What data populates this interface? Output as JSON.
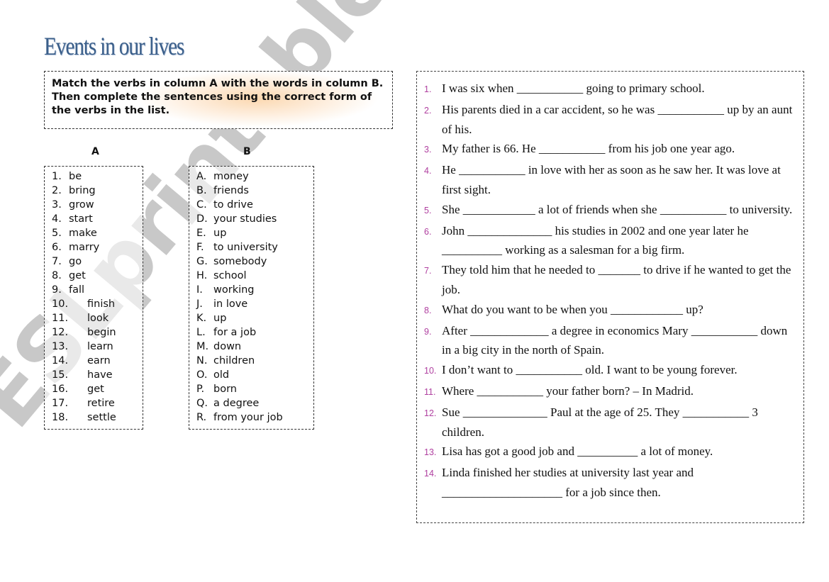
{
  "title": "Events in our lives",
  "instructions": "Match the verbs in column A with the words in column B. Then complete the sentences using the correct form of the verbs in the list.",
  "column_a": {
    "heading": "A",
    "items": [
      {
        "n": "1.",
        "w": "be"
      },
      {
        "n": "2.",
        "w": "bring"
      },
      {
        "n": "3.",
        "w": "grow"
      },
      {
        "n": "4.",
        "w": "start"
      },
      {
        "n": "5.",
        "w": "make"
      },
      {
        "n": "6.",
        "w": "marry"
      },
      {
        "n": "7.",
        "w": "go"
      },
      {
        "n": "8.",
        "w": "get"
      },
      {
        "n": "9.",
        "w": "fall"
      },
      {
        "n": "10.",
        "w": "finish"
      },
      {
        "n": "11.",
        "w": "look"
      },
      {
        "n": "12.",
        "w": "begin"
      },
      {
        "n": "13.",
        "w": "learn"
      },
      {
        "n": "14.",
        "w": "earn"
      },
      {
        "n": "15.",
        "w": "have"
      },
      {
        "n": "16.",
        "w": "get"
      },
      {
        "n": "17.",
        "w": "retire"
      },
      {
        "n": "18.",
        "w": "settle"
      }
    ]
  },
  "column_b": {
    "heading": "B",
    "items": [
      {
        "n": "A.",
        "w": "money"
      },
      {
        "n": "B.",
        "w": "friends"
      },
      {
        "n": "C.",
        "w": "to drive"
      },
      {
        "n": "D.",
        "w": "your studies"
      },
      {
        "n": "E.",
        "w": "up"
      },
      {
        "n": "F.",
        "w": "to university"
      },
      {
        "n": "G.",
        "w": "somebody"
      },
      {
        "n": "H.",
        "w": "school"
      },
      {
        "n": "I.",
        "w": "working"
      },
      {
        "n": "J.",
        "w": "in love"
      },
      {
        "n": "K.",
        "w": "up"
      },
      {
        "n": "L.",
        "w": "for a job"
      },
      {
        "n": "M.",
        "w": "down"
      },
      {
        "n": "N.",
        "w": "children"
      },
      {
        "n": "O.",
        "w": "old"
      },
      {
        "n": "P.",
        "w": "born"
      },
      {
        "n": "Q.",
        "w": "a degree"
      },
      {
        "n": "R.",
        "w": "from your job"
      }
    ]
  },
  "sentences": [
    {
      "n": "1.",
      "t": "I was six when ___________ going to primary school."
    },
    {
      "n": "2.",
      "t": "His parents died in a car accident, so he was ___________ up by an aunt of his."
    },
    {
      "n": "3.",
      "t": "My father is 66. He ___________ from his job one year ago."
    },
    {
      "n": "4.",
      "t": "He ___________ in love with her as soon as he saw her. It was love at first sight."
    },
    {
      "n": "5.",
      "t": "She ____________ a lot of friends when she ___________ to university."
    },
    {
      "n": "6.",
      "t": "John ______________ his studies in 2002 and one year later he __________ working as a salesman for a big firm."
    },
    {
      "n": "7.",
      "t": "They told him that he needed to _______ to drive if he wanted to get the job."
    },
    {
      "n": "8.",
      "t": "What do you want to be when you ____________ up?"
    },
    {
      "n": "9.",
      "t": "After _____________ a degree in economics Mary ___________ down in a big city in the north of Spain."
    },
    {
      "n": "10.",
      "t": "I don’t want to ___________ old. I want to be young forever."
    },
    {
      "n": "11.",
      "t": "Where ___________ your father born? – In Madrid."
    },
    {
      "n": "12.",
      "t": "Sue ______________ Paul at the age of 25. They ___________ 3 children."
    },
    {
      "n": "13.",
      "t": "Lisa has got a good job and __________ a lot of money."
    },
    {
      "n": "14.",
      "t": "Linda finished her studies at university last year and ____________________ for a job since then."
    }
  ],
  "watermark": "ESLprintables.com"
}
